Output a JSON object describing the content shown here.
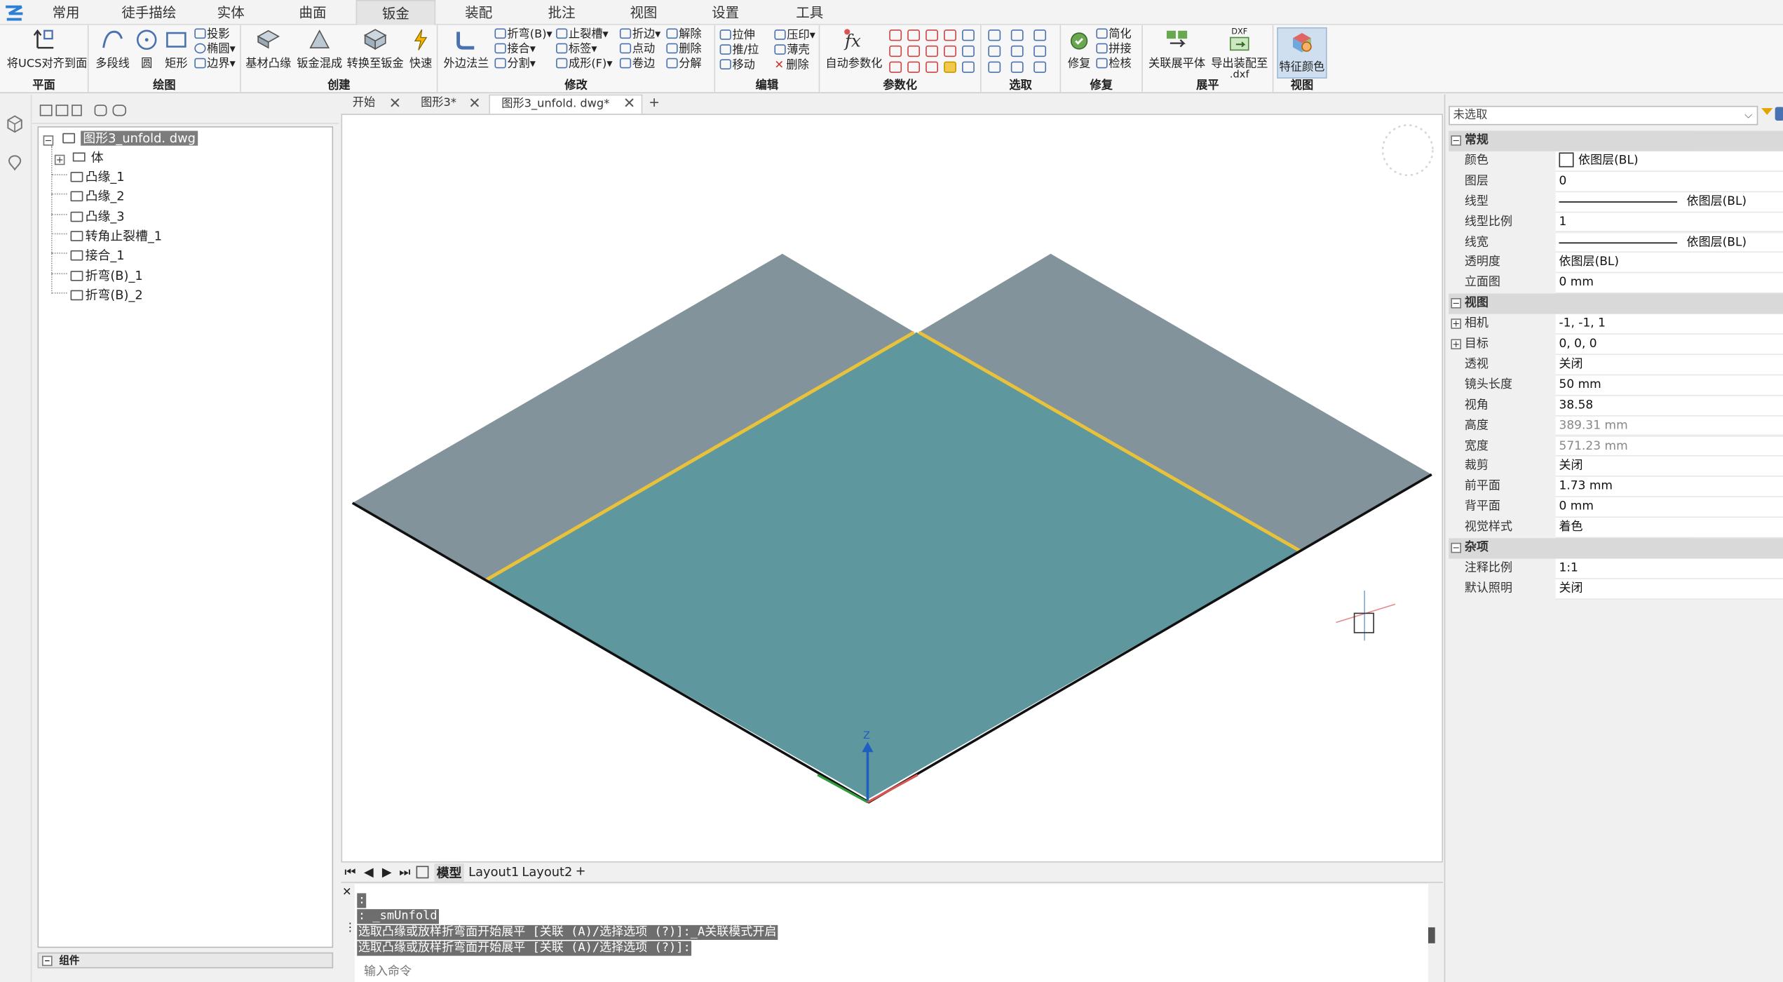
{
  "menu": {
    "tabs": [
      "常用",
      "徒手描绘",
      "实体",
      "曲面",
      "钣金",
      "装配",
      "批注",
      "视图",
      "设置",
      "工具"
    ],
    "active": "钣金"
  },
  "ribbon": {
    "plane": {
      "label": "平面",
      "align_ucs": "将UCS对齐到面"
    },
    "draw": {
      "label": "绘图",
      "polyline": "多段线",
      "circle": "圆",
      "rect": "矩形",
      "projection": "投影",
      "ellipse": "椭圆",
      "boundary": "边界"
    },
    "create": {
      "label": "创建",
      "base_flange": "基材凸缘",
      "lofted_bend": "钣金混成",
      "convert": "转换至钣金",
      "quick": "快速"
    },
    "modify": {
      "label": "修改",
      "flange": "外边法兰",
      "fold": "折弯(B)",
      "join": "接合",
      "split": "分割",
      "relief": "止裂槽",
      "tag": "标签",
      "form": "成形(F)",
      "bend_edge": "折边",
      "spot": "点动",
      "hem": "卷边",
      "unfold": "解除",
      "delete": "删除",
      "tear": "分解"
    },
    "edit": {
      "label": "编辑",
      "stretch": "拉伸",
      "push_pull": "推/拉",
      "move": "移动",
      "imprint": "压印",
      "shell": "薄壳",
      "delete": "删除"
    },
    "param": {
      "label": "参数化",
      "auto": "自动参数化"
    },
    "select": {
      "label": "选取"
    },
    "repair": {
      "label": "修复",
      "repair": "修复",
      "simplify": "简化",
      "stitch": "拼接",
      "check": "检核"
    },
    "flatten": {
      "label": "展平",
      "assoc": "关联展平体",
      "export": "导出装配至",
      "export2": ".dxf",
      "dxf": "DXF"
    },
    "view": {
      "label": "视图",
      "feature_color": "特征颜色"
    }
  },
  "tree": {
    "root": "图形3_unfold. dwg",
    "items": [
      "体",
      "凸缘_1",
      "凸缘_2",
      "凸缘_3",
      "转角止裂槽_1",
      "接合_1",
      "折弯(B)_1",
      "折弯(B)_2"
    ],
    "component_bar": "组件"
  },
  "doc_tabs": [
    "开始",
    "图形3*",
    "图形3_unfold. dwg*"
  ],
  "layout_tabs": [
    "模型",
    "Layout1",
    "Layout2"
  ],
  "command": {
    "lines": [
      ":",
      ": _smUnfold",
      "选取凸缘或放样折弯面开始展平 [关联 (A)/选择选项 (?)]:_A关联模式开启",
      "选取凸缘或放样折弯面开始展平 [关联 (A)/选择选项 (?)]:"
    ],
    "placeholder": "输入命令"
  },
  "properties": {
    "selection": "未选取",
    "sections": [
      {
        "title": "常规",
        "rows": [
          {
            "k": "颜色",
            "v": "依图层(BL)",
            "swatch": true
          },
          {
            "k": "图层",
            "v": "0"
          },
          {
            "k": "线型",
            "v": "依图层(BL)",
            "line": true
          },
          {
            "k": "线型比例",
            "v": "1"
          },
          {
            "k": "线宽",
            "v": "依图层(BL)",
            "line": true
          },
          {
            "k": "透明度",
            "v": "依图层(BL)"
          },
          {
            "k": "立面图",
            "v": "0 mm"
          }
        ]
      },
      {
        "title": "视图",
        "rows": [
          {
            "k": "相机",
            "v": "-1, -1, 1",
            "expand": true
          },
          {
            "k": "目标",
            "v": "0, 0, 0",
            "expand": true
          },
          {
            "k": "透视",
            "v": "关闭"
          },
          {
            "k": "镜头长度",
            "v": "50 mm"
          },
          {
            "k": "视角",
            "v": "38.58"
          },
          {
            "k": "高度",
            "v": "389.31 mm",
            "gray": true
          },
          {
            "k": "宽度",
            "v": "571.23 mm",
            "gray": true
          },
          {
            "k": "裁剪",
            "v": "关闭"
          },
          {
            "k": "前平面",
            "v": "1.73 mm"
          },
          {
            "k": "背平面",
            "v": "0 mm"
          },
          {
            "k": "视觉样式",
            "v": "着色"
          }
        ]
      },
      {
        "title": "杂项",
        "rows": [
          {
            "k": "注释比例",
            "v": "1:1"
          },
          {
            "k": "默认照明",
            "v": "关闭"
          }
        ]
      }
    ]
  },
  "colors": {
    "flange": "#83939b",
    "base": "#5f979e",
    "bendline": "#e8c23a",
    "accent": "#2b78c8"
  }
}
